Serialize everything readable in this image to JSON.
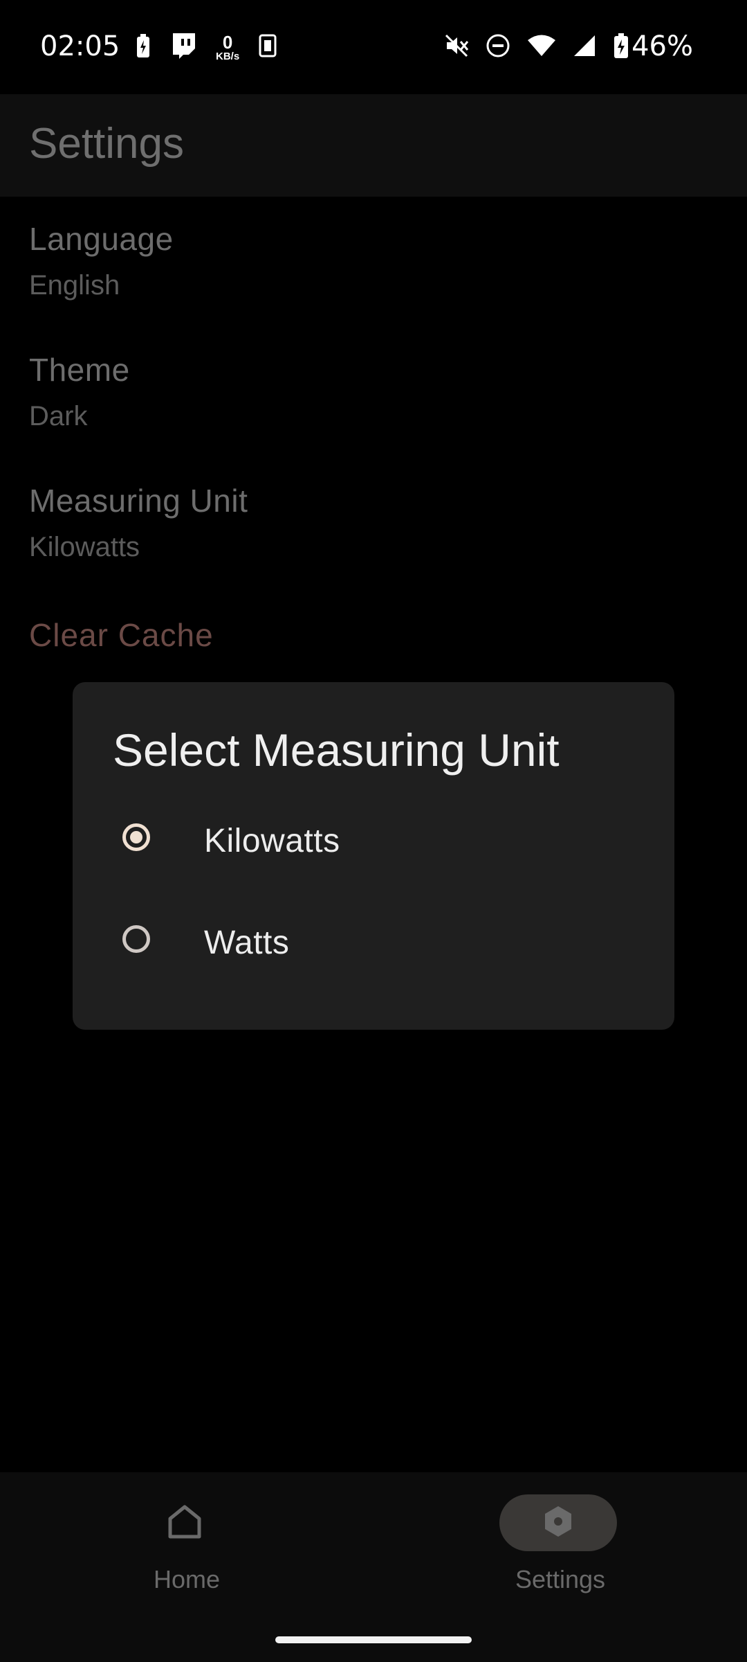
{
  "status_bar": {
    "time": "02:05",
    "net_speed_value": "0",
    "net_speed_unit": "KB/s",
    "battery_percent": "46%",
    "icons": [
      "battery-saver-icon",
      "twitch-icon",
      "net-speed",
      "sim-icon",
      "mute-icon",
      "dnd-icon",
      "wifi-icon",
      "signal-icon",
      "battery-charging-icon"
    ]
  },
  "app_bar": {
    "title": "Settings"
  },
  "settings": {
    "language": {
      "title": "Language",
      "value": "English"
    },
    "theme": {
      "title": "Theme",
      "value": "Dark"
    },
    "measuring_unit": {
      "title": "Measuring Unit",
      "value": "Kilowatts"
    },
    "clear_cache": "Clear Cache"
  },
  "dialog": {
    "title": "Select Measuring Unit",
    "options": [
      {
        "label": "Kilowatts",
        "selected": true
      },
      {
        "label": "Watts",
        "selected": false
      }
    ]
  },
  "bottom_nav": {
    "items": [
      {
        "label": "Home",
        "icon": "home-icon",
        "active": false
      },
      {
        "label": "Settings",
        "icon": "settings-icon",
        "active": true
      }
    ]
  },
  "colors": {
    "background": "#000000",
    "dialog_bg": "#1f1f1f",
    "radio_accent": "#f0e0d2",
    "clear_cache_text": "#6b4a46"
  }
}
